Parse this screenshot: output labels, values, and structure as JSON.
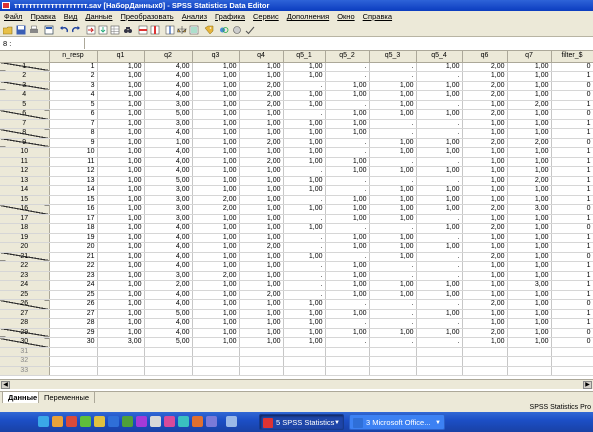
{
  "window": {
    "title": "тттттттттттттттттттт.sav [НаборДанных0] - SPSS Statistics Data Editor"
  },
  "menu": [
    "Файл",
    "Правка",
    "Вид",
    "Данные",
    "Преобразовать",
    "Анализ",
    "Графика",
    "Сервис",
    "Дополнения",
    "Окно",
    "Справка"
  ],
  "cell_ref": "8 :",
  "columns": [
    "n_resp",
    "q1",
    "q2",
    "q3",
    "q4",
    "q5_1",
    "q5_2",
    "q5_3",
    "q5_4",
    "q6",
    "q7",
    "filter_$"
  ],
  "rows": [
    [
      "1",
      "1,00",
      "4,00",
      "1,00",
      "1,00",
      "1,00",
      ".",
      ".",
      "1,00",
      "2,00",
      "1,00",
      "0"
    ],
    [
      "2",
      "1,00",
      "4,00",
      "1,00",
      "1,00",
      "1,00",
      ".",
      ".",
      ".",
      "1,00",
      "1,00",
      "1"
    ],
    [
      "3",
      "1,00",
      "4,00",
      "1,00",
      "2,00",
      ".",
      "1,00",
      "1,00",
      "1,00",
      "2,00",
      "1,00",
      "0"
    ],
    [
      "4",
      "1,00",
      "4,00",
      "1,00",
      "2,00",
      "1,00",
      "1,00",
      "1,00",
      "1,00",
      "2,00",
      "1,00",
      "0"
    ],
    [
      "5",
      "1,00",
      "3,00",
      "1,00",
      "2,00",
      "1,00",
      ".",
      "1,00",
      ".",
      "1,00",
      "2,00",
      "1"
    ],
    [
      "6",
      "1,00",
      "5,00",
      "1,00",
      "1,00",
      ".",
      "1,00",
      "1,00",
      "1,00",
      "2,00",
      "1,00",
      "0"
    ],
    [
      "7",
      "1,00",
      "3,00",
      "1,00",
      "1,00",
      "1,00",
      "1,00",
      ".",
      ".",
      "1,00",
      "1,00",
      "1"
    ],
    [
      "8",
      "1,00",
      "4,00",
      "1,00",
      "1,00",
      "1,00",
      "1,00",
      ".",
      ".",
      "1,00",
      "1,00",
      "1"
    ],
    [
      "9",
      "1,00",
      "1,00",
      "1,00",
      "2,00",
      "1,00",
      ".",
      "1,00",
      "1,00",
      "2,00",
      "2,00",
      "0"
    ],
    [
      "10",
      "1,00",
      "4,00",
      "1,00",
      "1,00",
      "1,00",
      ".",
      "1,00",
      "1,00",
      "1,00",
      "1,00",
      "1"
    ],
    [
      "11",
      "1,00",
      "4,00",
      "1,00",
      "2,00",
      "1,00",
      "1,00",
      ".",
      ".",
      "1,00",
      "1,00",
      "1"
    ],
    [
      "12",
      "1,00",
      "4,00",
      "1,00",
      "1,00",
      ".",
      "1,00",
      "1,00",
      "1,00",
      "1,00",
      "1,00",
      "1"
    ],
    [
      "13",
      "1,00",
      "5,00",
      "1,00",
      "1,00",
      "1,00",
      ".",
      ".",
      ".",
      "1,00",
      "2,00",
      "1"
    ],
    [
      "14",
      "1,00",
      "3,00",
      "1,00",
      "1,00",
      "1,00",
      ".",
      "1,00",
      "1,00",
      "1,00",
      "1,00",
      "1"
    ],
    [
      "15",
      "1,00",
      "3,00",
      "2,00",
      "1,00",
      ".",
      "1,00",
      "1,00",
      "1,00",
      "1,00",
      "1,00",
      "1"
    ],
    [
      "16",
      "1,00",
      "3,00",
      "2,00",
      "1,00",
      "1,00",
      "1,00",
      "1,00",
      "1,00",
      "2,00",
      "3,00",
      "0"
    ],
    [
      "17",
      "1,00",
      "3,00",
      "1,00",
      "1,00",
      ".",
      "1,00",
      "1,00",
      ".",
      "1,00",
      "1,00",
      "1"
    ],
    [
      "18",
      "1,00",
      "4,00",
      "1,00",
      "1,00",
      "1,00",
      ".",
      ".",
      "1,00",
      "2,00",
      "1,00",
      "0"
    ],
    [
      "19",
      "1,00",
      "4,00",
      "1,00",
      "1,00",
      ".",
      "1,00",
      "1,00",
      ".",
      "1,00",
      "1,00",
      "1"
    ],
    [
      "20",
      "1,00",
      "4,00",
      "1,00",
      "2,00",
      ".",
      "1,00",
      "1,00",
      "1,00",
      "1,00",
      "1,00",
      "1"
    ],
    [
      "21",
      "1,00",
      "4,00",
      "1,00",
      "1,00",
      "1,00",
      ".",
      "1,00",
      ".",
      "2,00",
      "1,00",
      "0"
    ],
    [
      "22",
      "1,00",
      "4,00",
      "1,00",
      "1,00",
      ".",
      "1,00",
      ".",
      ".",
      "1,00",
      "1,00",
      "1"
    ],
    [
      "23",
      "1,00",
      "3,00",
      "2,00",
      "1,00",
      ".",
      "1,00",
      ".",
      ".",
      "1,00",
      "1,00",
      "1"
    ],
    [
      "24",
      "1,00",
      "2,00",
      "1,00",
      "1,00",
      ".",
      "1,00",
      "1,00",
      "1,00",
      "1,00",
      "3,00",
      "1"
    ],
    [
      "25",
      "1,00",
      "4,00",
      "1,00",
      "2,00",
      ".",
      "1,00",
      "1,00",
      "1,00",
      "1,00",
      "1,00",
      "1"
    ],
    [
      "26",
      "1,00",
      "4,00",
      "1,00",
      "1,00",
      "1,00",
      ".",
      ".",
      ".",
      "2,00",
      "1,00",
      "0"
    ],
    [
      "27",
      "1,00",
      "5,00",
      "1,00",
      "1,00",
      "1,00",
      "1,00",
      ".",
      "1,00",
      "1,00",
      "1,00",
      "1"
    ],
    [
      "28",
      "1,00",
      "4,00",
      "1,00",
      "1,00",
      "1,00",
      ".",
      ".",
      ".",
      "1,00",
      "1,00",
      "1"
    ],
    [
      "29",
      "1,00",
      "4,00",
      "1,00",
      "1,00",
      "1,00",
      "1,00",
      "1,00",
      "1,00",
      "2,00",
      "1,00",
      "0"
    ],
    [
      "30",
      "3,00",
      "5,00",
      "1,00",
      "1,00",
      "1,00",
      ".",
      ".",
      ".",
      "1,00",
      "1,00",
      "0"
    ]
  ],
  "empty_rows": [
    "31",
    "32",
    "33"
  ],
  "view_tabs": {
    "data": "Данные",
    "variables": "Переменные"
  },
  "status": {
    "processor": "SPSS Statistics  Pro"
  },
  "taskbar": {
    "spss": "5 SPSS Statistics",
    "office": "3 Microsoft Office..."
  },
  "colors": {
    "title_bar": "#1a4bcd",
    "chrome": "#ece9d8",
    "taskbar": "#245edb"
  }
}
